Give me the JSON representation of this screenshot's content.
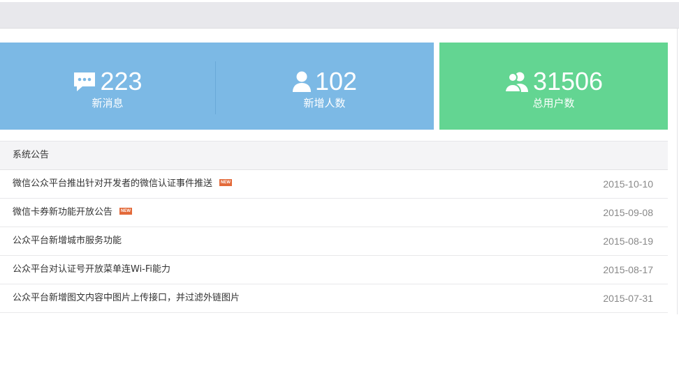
{
  "stats": [
    {
      "icon": "chat-bubble-icon",
      "value": "223",
      "label": "新消息"
    },
    {
      "icon": "user-icon",
      "value": "102",
      "label": "新增人数"
    },
    {
      "icon": "users-icon",
      "value": "31506",
      "label": "总用户数"
    }
  ],
  "colors": {
    "blue_panel": "#7cb9e5",
    "green_panel": "#63d592",
    "new_badge": "#e36a3a"
  },
  "notice": {
    "title": "系统公告",
    "badge_label": "NEW",
    "items": [
      {
        "title": "微信公众平台推出针对开发者的微信认证事件推送",
        "is_new": true,
        "date": "2015-10-10"
      },
      {
        "title": "微信卡券新功能开放公告",
        "is_new": true,
        "date": "2015-09-08"
      },
      {
        "title": "公众平台新增城市服务功能",
        "is_new": false,
        "date": "2015-08-19"
      },
      {
        "title": "公众平台对认证号开放菜单连Wi-Fi能力",
        "is_new": false,
        "date": "2015-08-17"
      },
      {
        "title": "公众平台新增图文内容中图片上传接口，并过滤外链图片",
        "is_new": false,
        "date": "2015-07-31"
      }
    ]
  }
}
